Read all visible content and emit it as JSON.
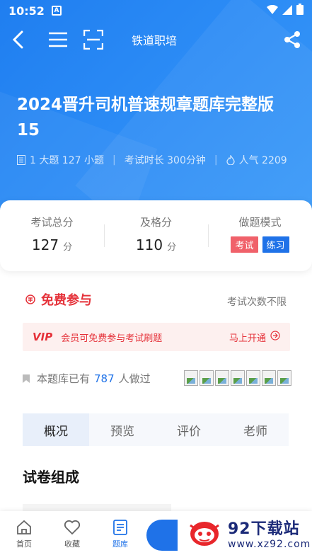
{
  "status": {
    "time": "10:52",
    "sim": "A"
  },
  "nav": {
    "title": "铁道职培"
  },
  "exam": {
    "title": "2024晋升司机普速规章题库完整版15",
    "meta_questions": "1 大题 127 小题",
    "meta_duration": "考试时长 300分钟",
    "meta_popularity": "人气 2209"
  },
  "score_card": {
    "total_label": "考试总分",
    "total_value": "127",
    "total_unit": "分",
    "pass_label": "及格分",
    "pass_value": "110",
    "pass_unit": "分",
    "mode_label": "做题模式",
    "mode_exam": "考试",
    "mode_practice": "练习"
  },
  "free": {
    "title": "免费参与",
    "attempts": "考试次数不限",
    "vip_badge": "VIP",
    "vip_text": "会员可免费参与考试刷题",
    "vip_cta": "马上开通"
  },
  "done": {
    "prefix": "本题库已有",
    "count": "787",
    "suffix": "人做过"
  },
  "tabs": [
    {
      "label": "概况",
      "active": true
    },
    {
      "label": "预览",
      "active": false
    },
    {
      "label": "评价",
      "active": false
    },
    {
      "label": "老师",
      "active": false
    }
  ],
  "section": {
    "title": "试卷组成"
  },
  "bottom": {
    "home": "首页",
    "favorites": "收藏",
    "question_bank": "题库"
  },
  "watermark": {
    "big": "92下载站",
    "small": "www.xz92.com"
  },
  "colors": {
    "primary": "#1f72e8",
    "accent_red": "#e5323a",
    "exam_tag": "#f0616a"
  }
}
